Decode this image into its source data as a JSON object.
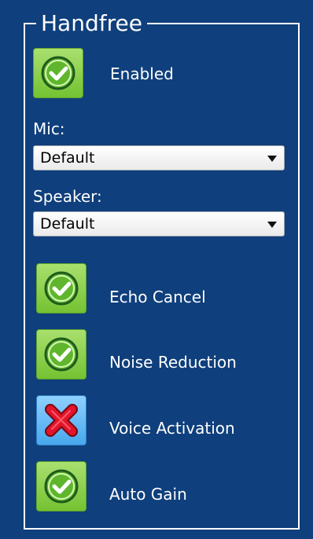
{
  "group": {
    "title": "Handfree"
  },
  "enabled": {
    "label": "Enabled",
    "state": "on",
    "icon": "check-circle-icon"
  },
  "mic": {
    "label": "Mic:",
    "selected": "Default"
  },
  "speaker": {
    "label": "Speaker:",
    "selected": "Default"
  },
  "options": [
    {
      "label": "Echo Cancel",
      "state": "on",
      "icon": "check-circle-icon"
    },
    {
      "label": "Noise Reduction",
      "state": "on",
      "icon": "check-circle-icon"
    },
    {
      "label": "Voice Activation",
      "state": "off",
      "icon": "red-x-icon"
    },
    {
      "label": "Auto Gain",
      "state": "on",
      "icon": "check-circle-icon"
    }
  ],
  "colors": {
    "background": "#0f3f7c",
    "toggle_on": "#7dc93a",
    "toggle_off": "#58b4f2",
    "off_mark": "#e1142a"
  }
}
